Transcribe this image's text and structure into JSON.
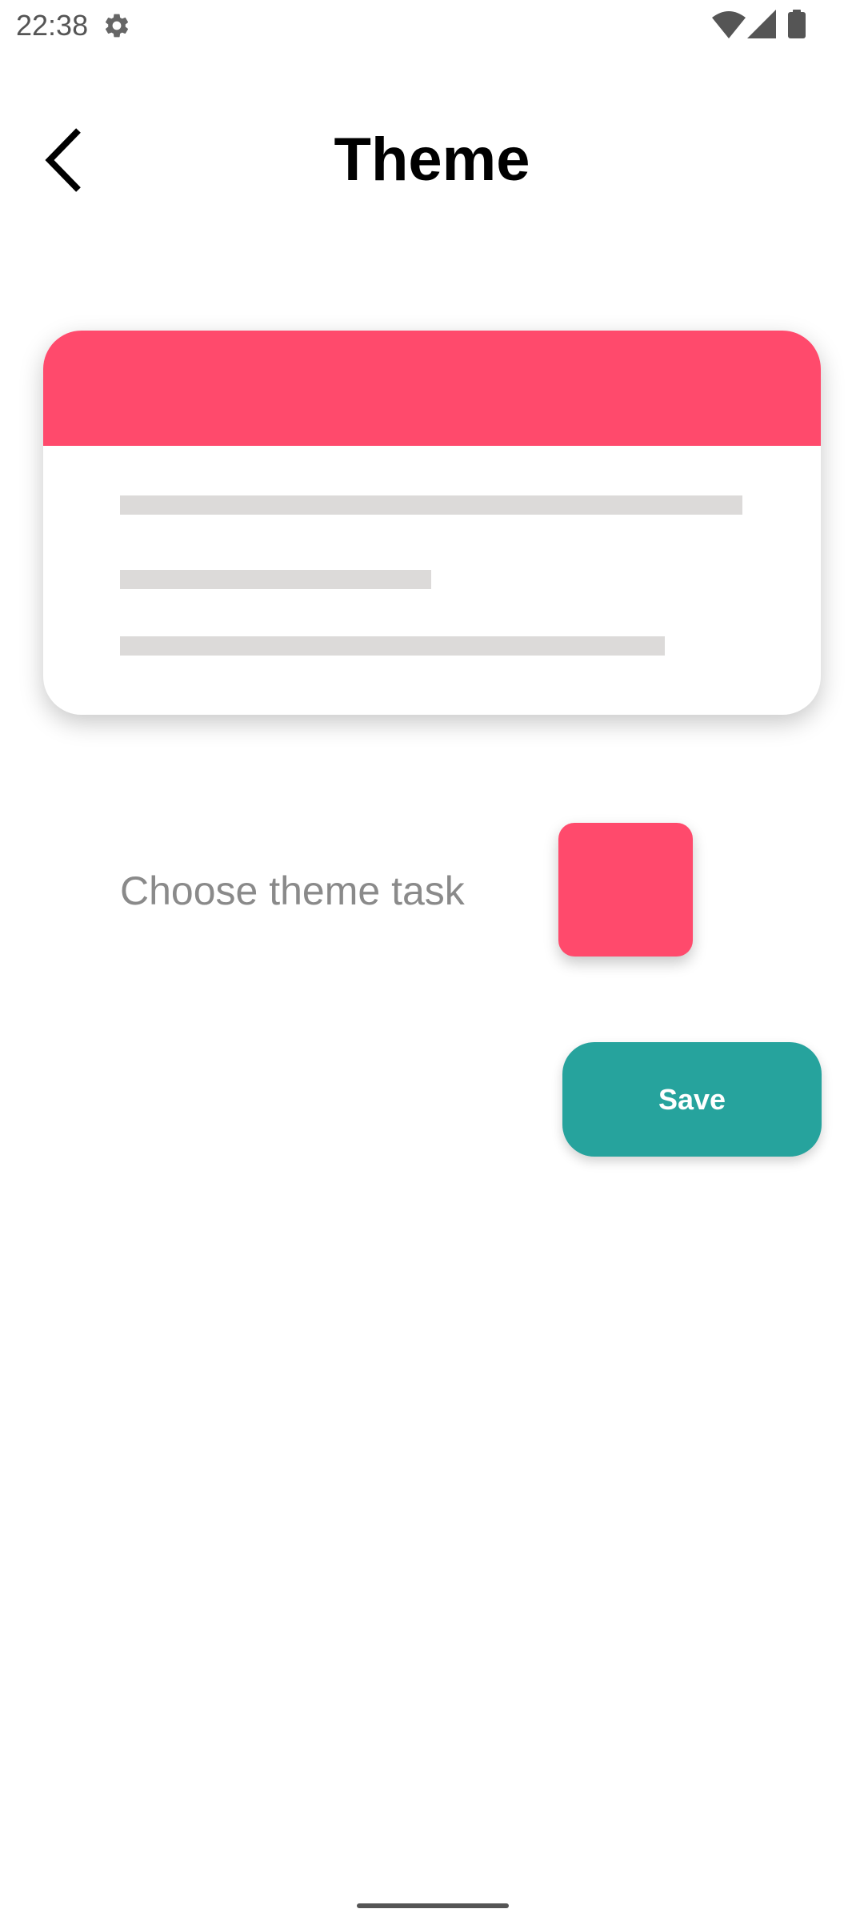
{
  "status_bar": {
    "time": "22:38",
    "icons": [
      "gear-icon",
      "wifi-icon",
      "signal-icon",
      "battery-icon"
    ]
  },
  "header": {
    "title": "Theme",
    "back_icon": "chevron-left-icon"
  },
  "theme_chooser": {
    "label": "Choose theme task",
    "selected_color": "#ff4a6c"
  },
  "save_button": {
    "label": "Save"
  },
  "colors": {
    "accent": "#ff4a6c",
    "save_button": "#26a39d",
    "placeholder_line": "#dcdad9",
    "label_text": "#8a8a8a"
  }
}
